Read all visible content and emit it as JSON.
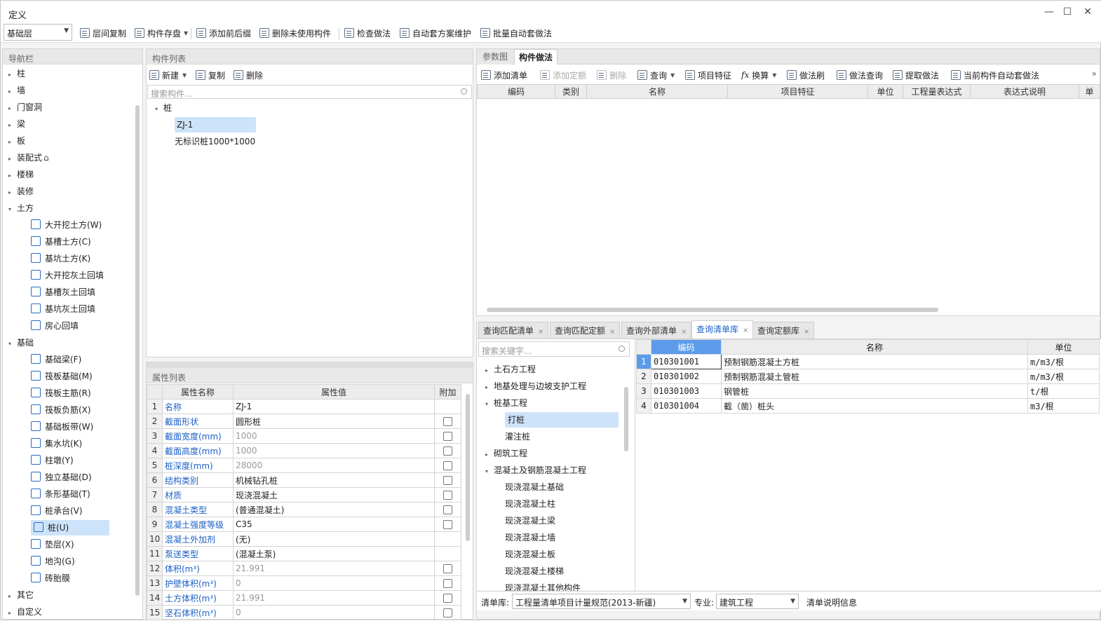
{
  "window": {
    "title": "定义",
    "controls": [
      "—",
      "☐",
      "✕"
    ]
  },
  "toolbar": {
    "floor_select": "基础层",
    "items": [
      "层间复制",
      "构件存盘",
      "添加前后缀",
      "删除未使用构件",
      "检查做法",
      "自动套方案维护",
      "批量自动套做法"
    ],
    "dropdown_index": 1
  },
  "nav": {
    "title": "导航栏",
    "items": [
      {
        "label": "柱",
        "level": 0,
        "caret": "▸"
      },
      {
        "label": "墙",
        "level": 0,
        "caret": "▸"
      },
      {
        "label": "门窗洞",
        "level": 0,
        "caret": "▸"
      },
      {
        "label": "梁",
        "level": 0,
        "caret": "▸"
      },
      {
        "label": "板",
        "level": 0,
        "caret": "▸"
      },
      {
        "label": "装配式",
        "level": 0,
        "caret": "▸",
        "suffix": "⌂"
      },
      {
        "label": "楼梯",
        "level": 0,
        "caret": "▸"
      },
      {
        "label": "装修",
        "level": 0,
        "caret": "▸"
      },
      {
        "label": "土方",
        "level": 0,
        "caret": "▾"
      },
      {
        "label": "大开挖土方(W)",
        "level": 1
      },
      {
        "label": "基槽土方(C)",
        "level": 1
      },
      {
        "label": "基坑土方(K)",
        "level": 1
      },
      {
        "label": "大开挖灰土回填",
        "level": 1
      },
      {
        "label": "基槽灰土回填",
        "level": 1
      },
      {
        "label": "基坑灰土回填",
        "level": 1
      },
      {
        "label": "房心回填",
        "level": 1
      },
      {
        "label": "基础",
        "level": 0,
        "caret": "▾"
      },
      {
        "label": "基础梁(F)",
        "level": 1
      },
      {
        "label": "筏板基础(M)",
        "level": 1
      },
      {
        "label": "筏板主筋(R)",
        "level": 1
      },
      {
        "label": "筏板负筋(X)",
        "level": 1
      },
      {
        "label": "基础板带(W)",
        "level": 1
      },
      {
        "label": "集水坑(K)",
        "level": 1
      },
      {
        "label": "柱墩(Y)",
        "level": 1
      },
      {
        "label": "独立基础(D)",
        "level": 1
      },
      {
        "label": "条形基础(T)",
        "level": 1
      },
      {
        "label": "桩承台(V)",
        "level": 1
      },
      {
        "label": "桩(U)",
        "level": 1,
        "selected": true
      },
      {
        "label": "垫层(X)",
        "level": 1
      },
      {
        "label": "地沟(G)",
        "level": 1
      },
      {
        "label": "砖胎膜",
        "level": 1
      },
      {
        "label": "其它",
        "level": 0,
        "caret": "▸"
      },
      {
        "label": "自定义",
        "level": 0,
        "caret": "▸"
      }
    ]
  },
  "component_list": {
    "title": "构件列表",
    "toolbar": [
      "新建",
      "复制",
      "删除"
    ],
    "search_placeholder": "搜索构件...",
    "tree": [
      {
        "label": "桩",
        "level": 0,
        "caret": "▾"
      },
      {
        "label": "ZJ-1",
        "level": 1,
        "selected": true
      },
      {
        "label": "无标识桩1000*1000",
        "level": 1
      }
    ]
  },
  "properties": {
    "title": "属性列表",
    "headers": [
      "",
      "属性名称",
      "属性值",
      "附加"
    ],
    "rows": [
      {
        "n": "1",
        "name": "名称",
        "value": "ZJ-1",
        "gray": false,
        "chk": false
      },
      {
        "n": "2",
        "name": "截面形状",
        "value": "圆形桩",
        "gray": false,
        "chk": true
      },
      {
        "n": "3",
        "name": "截面宽度(mm)",
        "value": "1000",
        "gray": true,
        "chk": true
      },
      {
        "n": "4",
        "name": "截面高度(mm)",
        "value": "1000",
        "gray": true,
        "chk": true
      },
      {
        "n": "5",
        "name": "桩深度(mm)",
        "value": "28000",
        "gray": true,
        "chk": true
      },
      {
        "n": "6",
        "name": "结构类别",
        "value": "机械钻孔桩",
        "gray": false,
        "chk": true
      },
      {
        "n": "7",
        "name": "材质",
        "value": "现浇混凝土",
        "gray": false,
        "chk": true
      },
      {
        "n": "8",
        "name": "混凝土类型",
        "value": "(普通混凝土)",
        "gray": false,
        "chk": true
      },
      {
        "n": "9",
        "name": "混凝土强度等级",
        "value": "C35",
        "gray": false,
        "chk": true
      },
      {
        "n": "10",
        "name": "混凝土外加剂",
        "value": "(无)",
        "gray": false,
        "chk": false
      },
      {
        "n": "11",
        "name": "泵送类型",
        "value": "(混凝土泵)",
        "gray": false,
        "chk": false
      },
      {
        "n": "12",
        "name": "体积(m³)",
        "value": "21.991",
        "gray": true,
        "chk": true
      },
      {
        "n": "13",
        "name": "护壁体积(m³)",
        "value": "0",
        "gray": true,
        "chk": true
      },
      {
        "n": "14",
        "name": "土方体积(m³)",
        "value": "21.991",
        "gray": true,
        "chk": true
      },
      {
        "n": "15",
        "name": "坚石体积(m³)",
        "value": "0",
        "gray": true,
        "chk": true
      }
    ]
  },
  "method": {
    "tabs": [
      "参数图",
      "构件做法"
    ],
    "active_tab": 1,
    "toolbar": [
      {
        "label": "添加清单",
        "disabled": false,
        "drop": false
      },
      {
        "label": "添加定额",
        "disabled": true,
        "drop": false
      },
      {
        "label": "删除",
        "disabled": true,
        "drop": false
      },
      {
        "label": "查询",
        "disabled": false,
        "drop": true
      },
      {
        "label": "项目特征",
        "disabled": false,
        "drop": false
      },
      {
        "label": "换算",
        "disabled": false,
        "drop": true,
        "fx": "fx"
      },
      {
        "label": "做法刷",
        "disabled": false,
        "drop": false
      },
      {
        "label": "做法查询",
        "disabled": false,
        "drop": false
      },
      {
        "label": "提取做法",
        "disabled": false,
        "drop": false
      },
      {
        "label": "当前构件自动套做法",
        "disabled": false,
        "drop": false
      }
    ],
    "more": "»",
    "columns": [
      "编码",
      "类别",
      "名称",
      "项目特征",
      "单位",
      "工程量表达式",
      "表达式说明",
      "单"
    ]
  },
  "query": {
    "tabs": [
      "查询匹配清单",
      "查询匹配定额",
      "查询外部清单",
      "查询清单库",
      "查询定额库"
    ],
    "active_tab": 3,
    "close_glyph": "×",
    "search_placeholder": "搜索关键字...",
    "tree": [
      {
        "label": "土石方工程",
        "level": 0,
        "caret": "▸"
      },
      {
        "label": "地基处理与边坡支护工程",
        "level": 0,
        "caret": "▸"
      },
      {
        "label": "桩基工程",
        "level": 0,
        "caret": "▾"
      },
      {
        "label": "打桩",
        "level": 1,
        "selected": true
      },
      {
        "label": "灌注桩",
        "level": 1
      },
      {
        "label": "砌筑工程",
        "level": 0,
        "caret": "▸"
      },
      {
        "label": "混凝土及钢筋混凝土工程",
        "level": 0,
        "caret": "▾"
      },
      {
        "label": "现浇混凝土基础",
        "level": 1
      },
      {
        "label": "现浇混凝土柱",
        "level": 1
      },
      {
        "label": "现浇混凝土梁",
        "level": 1
      },
      {
        "label": "现浇混凝土墙",
        "level": 1
      },
      {
        "label": "现浇混凝土板",
        "level": 1
      },
      {
        "label": "现浇混凝土楼梯",
        "level": 1
      },
      {
        "label": "现浇混凝土其他构件",
        "level": 1
      }
    ],
    "table_headers": [
      "",
      "编码",
      "名称",
      "单位"
    ],
    "rows": [
      {
        "n": "1",
        "code": "010301001",
        "name": "预制钢筋混凝土方桩",
        "unit": "m/m3/根"
      },
      {
        "n": "2",
        "code": "010301002",
        "name": "预制钢筋混凝土管桩",
        "unit": "m/m3/根"
      },
      {
        "n": "3",
        "code": "010301003",
        "name": "钢管桩",
        "unit": "t/根"
      },
      {
        "n": "4",
        "code": "010301004",
        "name": "截（凿）桩头",
        "unit": "m3/根"
      }
    ],
    "status": {
      "lib_label": "清单库:",
      "lib_value": "工程量清单项目计量规范(2013-新疆)",
      "spec_label": "专业:",
      "spec_value": "建筑工程",
      "info": "清单说明信息"
    }
  },
  "colors": {
    "accent": "#1b63c8",
    "selected_bg": "#cde3fa",
    "header_sel": "#5b9bea"
  }
}
